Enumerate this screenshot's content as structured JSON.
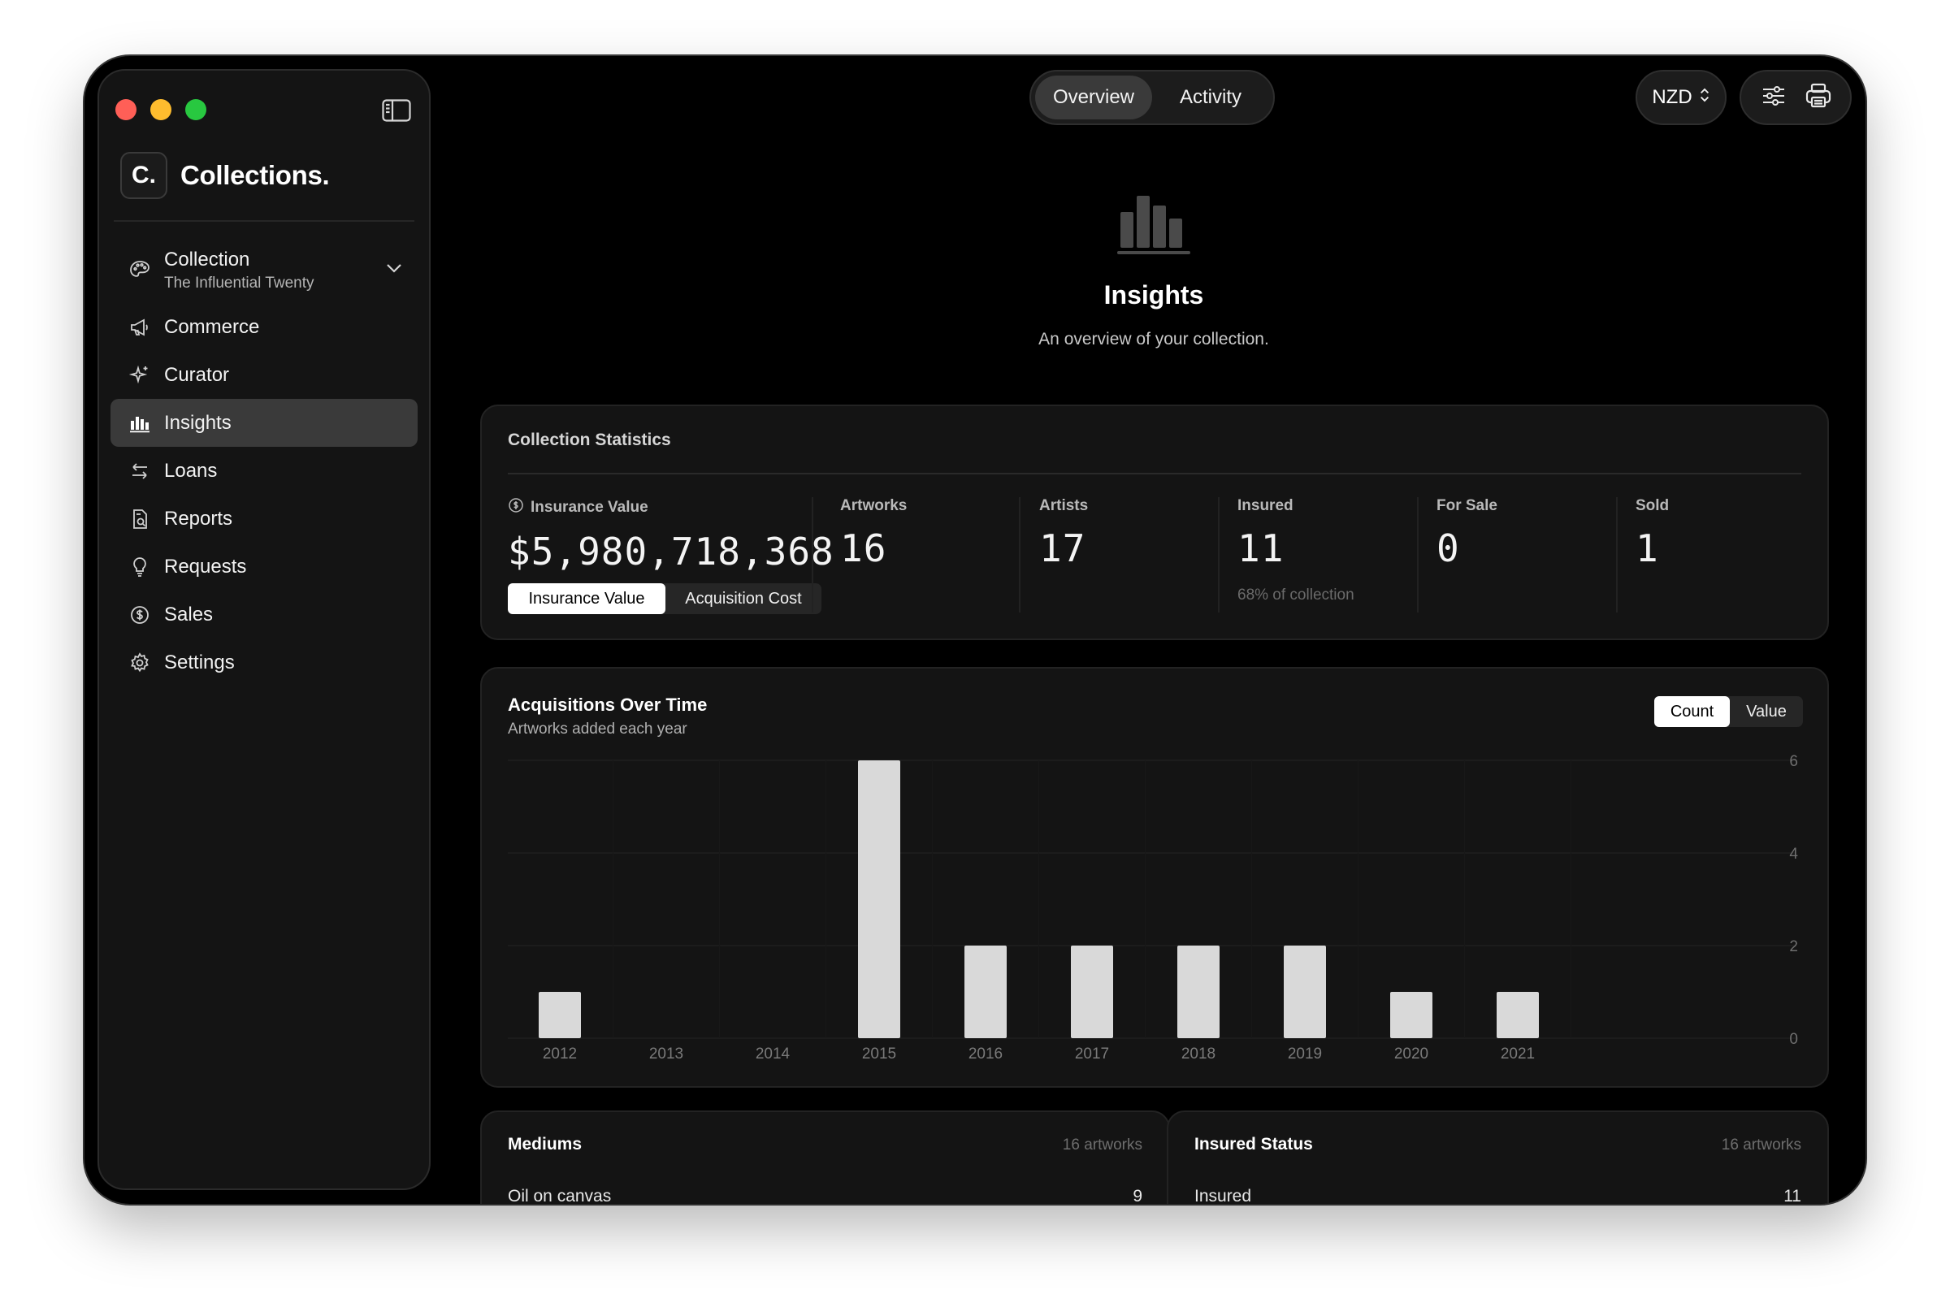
{
  "window": {
    "brand_initial": "C.",
    "brand_name": "Collections."
  },
  "sidebar": {
    "items": [
      {
        "label": "Collection",
        "sub": "The Influential Twenty",
        "icon": "palette-icon"
      },
      {
        "label": "Commerce",
        "icon": "megaphone-icon"
      },
      {
        "label": "Curator",
        "icon": "sparkle-icon"
      },
      {
        "label": "Insights",
        "icon": "bar-chart-icon",
        "active": true
      },
      {
        "label": "Loans",
        "icon": "arrows-exchange-icon"
      },
      {
        "label": "Reports",
        "icon": "document-search-icon"
      },
      {
        "label": "Requests",
        "icon": "lightbulb-icon"
      },
      {
        "label": "Sales",
        "icon": "dollar-circle-icon"
      },
      {
        "label": "Settings",
        "icon": "gear-icon"
      }
    ]
  },
  "topbar": {
    "tabs": [
      "Overview",
      "Activity"
    ],
    "active_tab": "Overview",
    "currency": "NZD"
  },
  "hero": {
    "title": "Insights",
    "subtitle": "An overview of your collection."
  },
  "stats": {
    "title": "Collection Statistics",
    "insurance_label": "Insurance Value",
    "insurance_value": "$5,980,718,368",
    "toggle": [
      "Insurance Value",
      "Acquisition Cost"
    ],
    "artworks_label": "Artworks",
    "artworks_value": "16",
    "artists_label": "Artists",
    "artists_value": "17",
    "insured_label": "Insured",
    "insured_value": "11",
    "insured_note": "68% of collection",
    "forsale_label": "For Sale",
    "forsale_value": "0",
    "sold_label": "Sold",
    "sold_value": "1"
  },
  "acquisitions": {
    "title": "Acquisitions Over Time",
    "subtitle": "Artworks added each year",
    "toggle": [
      "Count",
      "Value"
    ]
  },
  "chart_data": {
    "type": "bar",
    "categories": [
      "2012",
      "2013",
      "2014",
      "2015",
      "2016",
      "2017",
      "2018",
      "2019",
      "2020",
      "2021"
    ],
    "values": [
      1,
      0,
      0,
      6,
      2,
      2,
      2,
      2,
      1,
      1
    ],
    "yticks": [
      0,
      2,
      4,
      6
    ],
    "ylim": [
      0,
      6
    ],
    "grid": true,
    "colors": {
      "bar": "#d9d9d9"
    }
  },
  "mediums": {
    "title": "Mediums",
    "count": "16 artworks",
    "row_label": "Oil on canvas",
    "row_value": "9"
  },
  "insured_status": {
    "title": "Insured Status",
    "count": "16 artworks",
    "row_label": "Insured",
    "row_value": "11"
  }
}
